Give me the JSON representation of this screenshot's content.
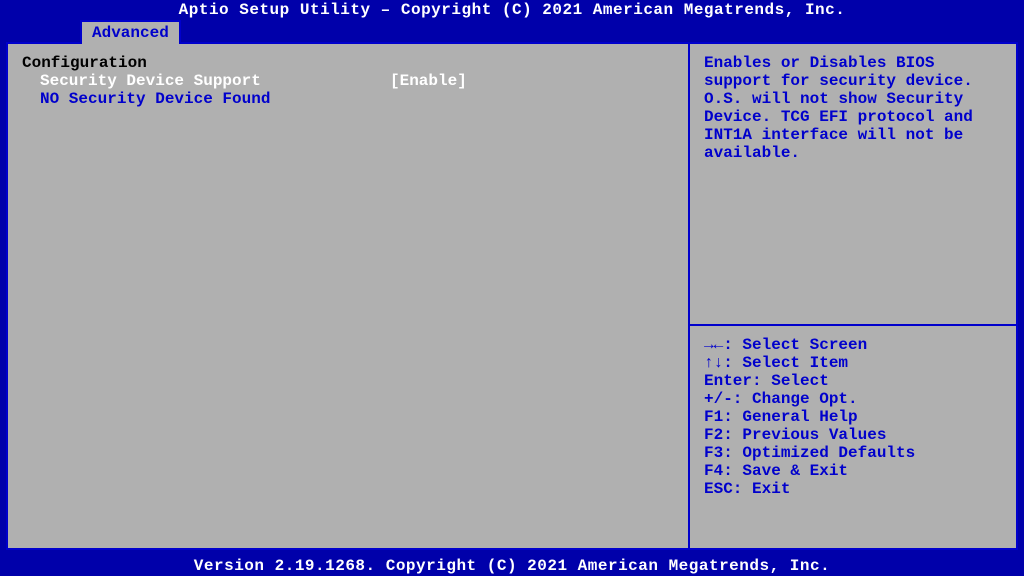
{
  "header": {
    "title": "Aptio Setup Utility – Copyright (C) 2021 American Megatrends, Inc."
  },
  "tab": {
    "label": "Advanced"
  },
  "left": {
    "section_title": "Configuration",
    "setting_label": "Security Device Support",
    "setting_value": "[Enable]",
    "info_line": "NO Security Device Found"
  },
  "help": {
    "text": "Enables or Disables BIOS support for security device. O.S. will not show Security Device. TCG EFI protocol and INT1A interface will not be available."
  },
  "keys": {
    "k1": "→←: Select Screen",
    "k2": "↑↓: Select Item",
    "k3": "Enter: Select",
    "k4": "+/-: Change Opt.",
    "k5": "F1: General Help",
    "k6": "F2: Previous Values",
    "k7": "F3: Optimized Defaults",
    "k8": "F4: Save & Exit",
    "k9": "ESC: Exit"
  },
  "footer": {
    "text": "Version 2.19.1268. Copyright (C) 2021 American Megatrends, Inc."
  }
}
